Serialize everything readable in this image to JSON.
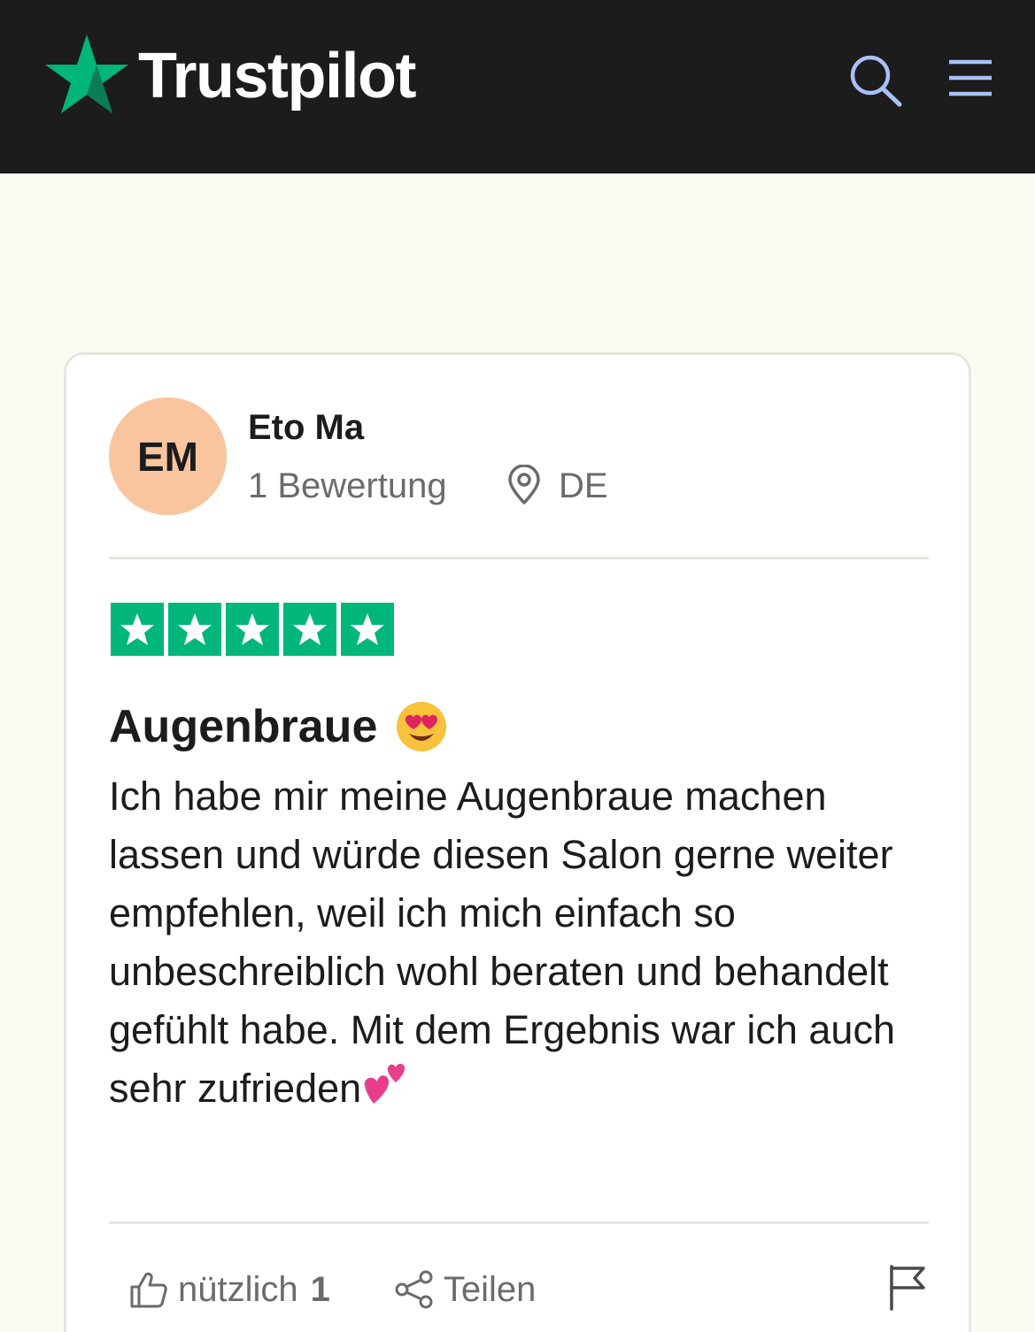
{
  "header": {
    "brand": "Trustpilot",
    "brand_color": "#00b67a",
    "background": "#1c1c1c",
    "search_icon": "search-icon",
    "menu_icon": "menu-icon"
  },
  "review": {
    "reviewer": {
      "initials": "EM",
      "name": "Eto Ma",
      "review_count": "1 Bewertung",
      "country": "DE",
      "avatar_color": "#f9c59e"
    },
    "rating": 5,
    "rating_max": 5,
    "title": "Augenbraue",
    "body": "Ich habe mir meine Augenbraue machen lassen und würde diesen Salon gerne weiter empfehlen, weil ich mich einfach so unbeschreiblich wohl beraten und behandelt gefühlt habe. Mit dem Ergebnis war ich auch sehr zufrieden",
    "actions": {
      "useful_label": "nützlich",
      "useful_count": "1",
      "share_label": "Teilen"
    }
  }
}
